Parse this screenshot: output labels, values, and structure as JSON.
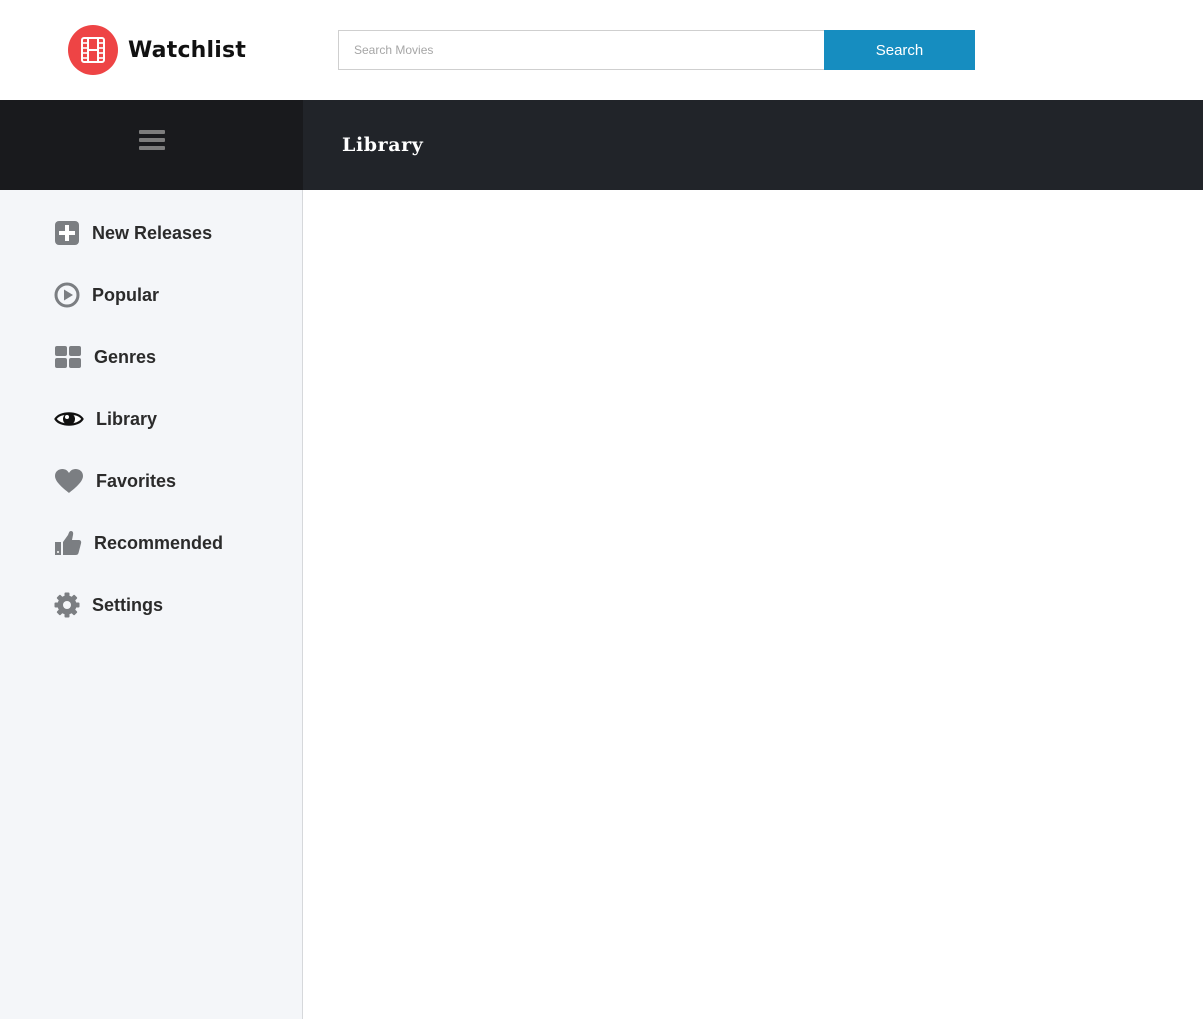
{
  "app": {
    "name": "Watchlist",
    "accent_color": "#ee4445",
    "logo_icon": "film-icon"
  },
  "search": {
    "placeholder": "Search Movies",
    "value": "",
    "button_label": "Search",
    "button_color": "#168dc0"
  },
  "topbar": {
    "menu_icon": "hamburger-menu-icon",
    "page_title": "Library"
  },
  "sidebar": {
    "items": [
      {
        "label": "New Releases",
        "icon": "plus-square-icon"
      },
      {
        "label": "Popular",
        "icon": "play-circle-icon"
      },
      {
        "label": "Genres",
        "icon": "grid-icon"
      },
      {
        "label": "Library",
        "icon": "eye-icon",
        "active": true
      },
      {
        "label": "Favorites",
        "icon": "heart-icon"
      },
      {
        "label": "Recommended",
        "icon": "thumbs-up-icon"
      },
      {
        "label": "Settings",
        "icon": "gear-icon"
      }
    ]
  }
}
